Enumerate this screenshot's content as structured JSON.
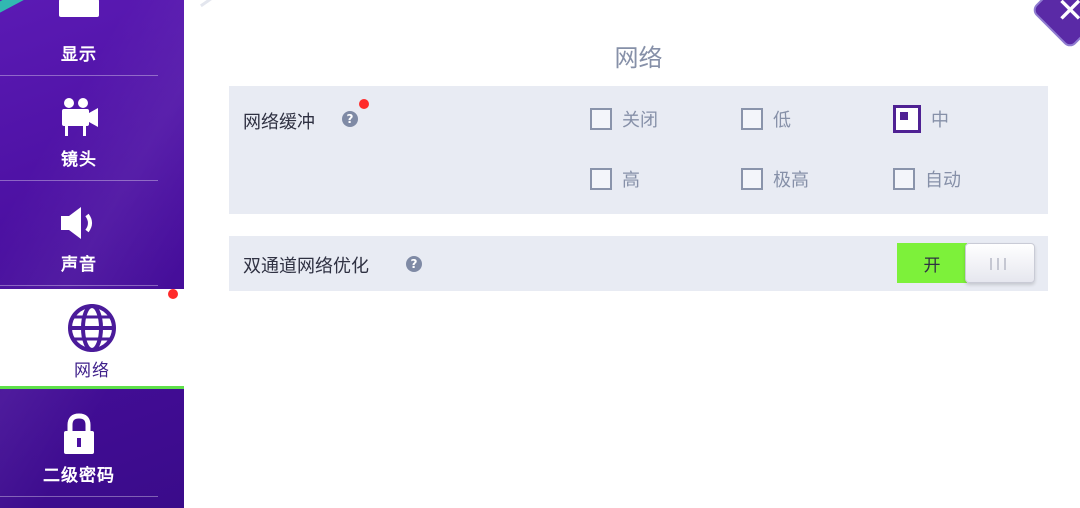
{
  "sidebar": {
    "items": [
      {
        "label": "显示",
        "icon": "display-icon"
      },
      {
        "label": "镜头",
        "icon": "camera-icon"
      },
      {
        "label": "声音",
        "icon": "speaker-icon"
      },
      {
        "label": "网络",
        "icon": "globe-icon",
        "active": true,
        "notification": true
      },
      {
        "label": "二级密码",
        "icon": "lock-icon"
      }
    ]
  },
  "close_button": {
    "icon": "close-icon"
  },
  "main": {
    "title": "网络",
    "network_buffer": {
      "label": "网络缓冲",
      "help_icon": "help-icon",
      "notification": true,
      "options": [
        {
          "label": "关闭",
          "checked": false
        },
        {
          "label": "低",
          "checked": false
        },
        {
          "label": "中",
          "checked": true
        },
        {
          "label": "高",
          "checked": false
        },
        {
          "label": "极高",
          "checked": false
        },
        {
          "label": "自动",
          "checked": false
        }
      ]
    },
    "dual_channel": {
      "label": "双通道网络优化",
      "help_icon": "help-icon",
      "toggle_label": "开",
      "enabled": true
    }
  },
  "colors": {
    "sidebar_purple": "#4a0fa0",
    "accent_green": "#7df13a",
    "checked_purple": "#4f2193",
    "notification_red": "#ff2a2a"
  }
}
